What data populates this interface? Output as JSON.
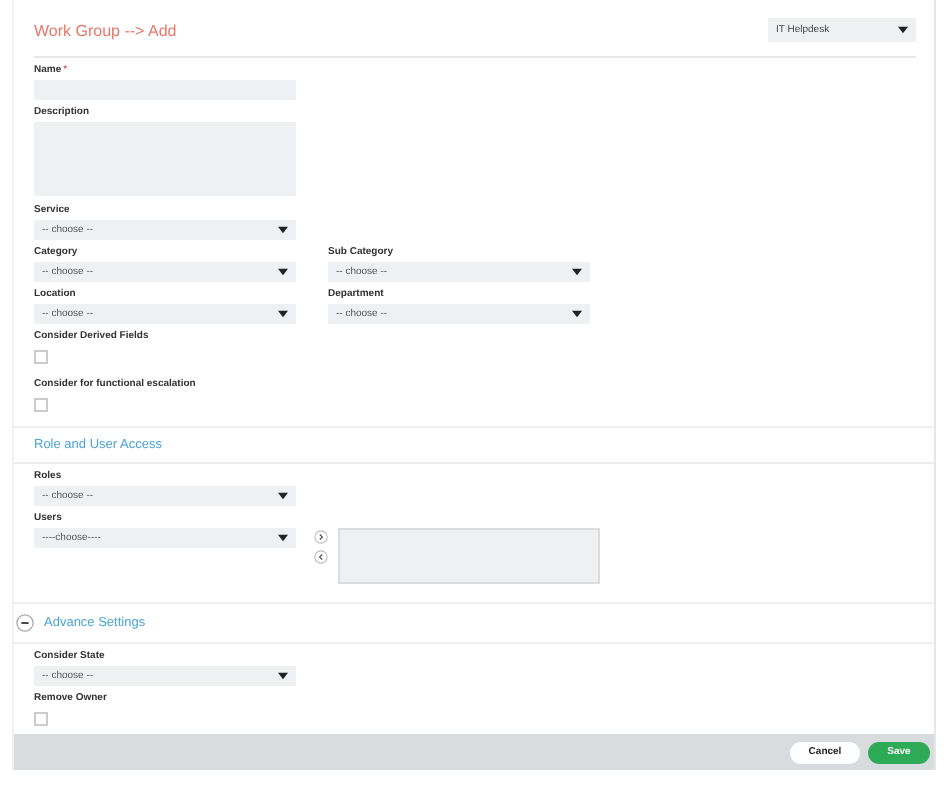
{
  "header": {
    "title": "Work Group --> Add",
    "workspace": "IT Helpdesk"
  },
  "main_fields": [
    {
      "kind": "text",
      "label": "Name",
      "required_mark": "*"
    },
    {
      "kind": "textarea",
      "label": "Description"
    },
    {
      "kind": "select",
      "label": "Service",
      "value": "-- choose --"
    },
    {
      "kind": "pair",
      "items": [
        {
          "label": "Category",
          "value": "-- choose --"
        },
        {
          "label": "Sub Category",
          "value": "-- choose --"
        }
      ]
    },
    {
      "kind": "pair",
      "items": [
        {
          "label": "Location",
          "value": "-- choose --"
        },
        {
          "label": "Department",
          "value": "-- choose --"
        }
      ]
    },
    {
      "kind": "checkbox",
      "label": "Consider Derived Fields",
      "checked": false
    },
    {
      "kind": "checkbox",
      "label": "Consider for functional escalation",
      "checked": false
    }
  ],
  "role_section": {
    "title": "Role and User Access",
    "fields": [
      {
        "kind": "select",
        "label": "Roles",
        "value": "-- choose --"
      },
      {
        "kind": "users",
        "label": "Users",
        "value": "----choose----"
      }
    ]
  },
  "advance_section": {
    "title": "Advance Settings",
    "expanded": true,
    "fields": [
      {
        "kind": "select",
        "label": "Consider State",
        "value": "-- choose --"
      },
      {
        "kind": "checkbox",
        "label": "Remove Owner",
        "checked": false
      }
    ]
  },
  "buttons": [
    {
      "label": "Cancel",
      "kind": "secondary"
    },
    {
      "label": "Save",
      "kind": "primary"
    }
  ]
}
